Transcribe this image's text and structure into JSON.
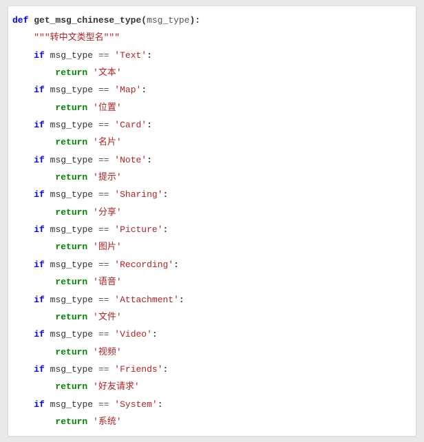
{
  "code": {
    "def_kw": "def",
    "func_name": "get_msg_chinese_type",
    "param": "msg_type",
    "docstring": "\"\"\"转中文类型名\"\"\"",
    "if_kw": "if",
    "return_kw": "return",
    "var": "msg_type",
    "eq": "==",
    "cases": [
      {
        "test": "'Text'",
        "ret": "'文本'"
      },
      {
        "test": "'Map'",
        "ret": "'位置'"
      },
      {
        "test": "'Card'",
        "ret": "'名片'"
      },
      {
        "test": "'Note'",
        "ret": "'提示'"
      },
      {
        "test": "'Sharing'",
        "ret": "'分享'"
      },
      {
        "test": "'Picture'",
        "ret": "'图片'"
      },
      {
        "test": "'Recording'",
        "ret": "'语音'"
      },
      {
        "test": "'Attachment'",
        "ret": "'文件'"
      },
      {
        "test": "'Video'",
        "ret": "'视频'"
      },
      {
        "test": "'Friends'",
        "ret": "'好友请求'"
      },
      {
        "test": "'System'",
        "ret": "'系统'"
      }
    ]
  }
}
